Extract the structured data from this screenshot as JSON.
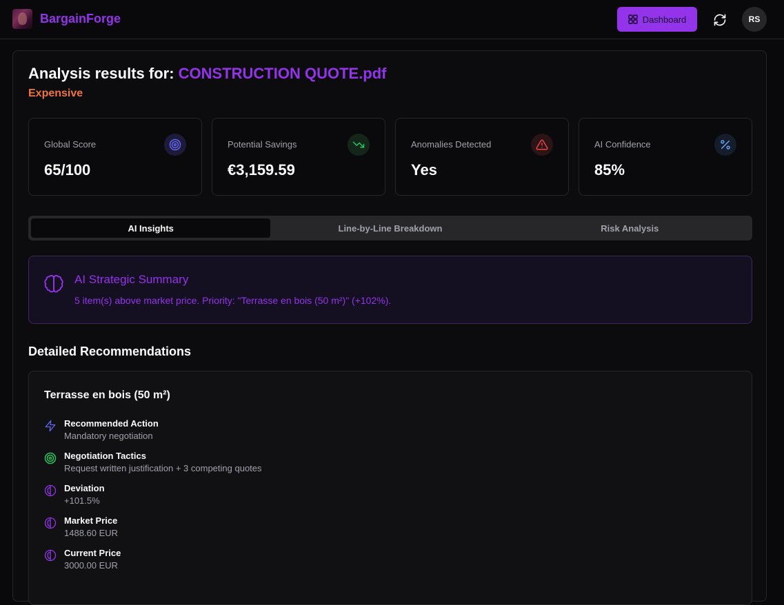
{
  "app": {
    "name": "BargainForge",
    "dashboard_label": "Dashboard",
    "user_initials": "RS"
  },
  "analysis": {
    "heading_prefix": "Analysis results for:",
    "file_name": "CONSTRUCTION QUOTE.pdf",
    "verdict": "Expensive",
    "verdict_color": "#f0743c"
  },
  "cards": [
    {
      "label": "Global Score",
      "value": "65/100",
      "icon": "target-icon",
      "color": "#4f46e5"
    },
    {
      "label": "Potential Savings",
      "value": "€3,159.59",
      "icon": "trending-down-icon",
      "color": "#22c55e"
    },
    {
      "label": "Anomalies Detected",
      "value": "Yes",
      "icon": "alert-triangle-icon",
      "color": "#ef4444"
    },
    {
      "label": "AI Confidence",
      "value": "85%",
      "icon": "percent-icon",
      "color": "#60a5fa"
    }
  ],
  "tabs": [
    {
      "label": "AI Insights",
      "active": true
    },
    {
      "label": "Line-by-Line Breakdown",
      "active": false
    },
    {
      "label": "Risk Analysis",
      "active": false
    }
  ],
  "summary": {
    "title": "AI Strategic Summary",
    "text": "5 item(s) above market price. Priority: \"Terrasse en bois (50 m²)\" (+102%)."
  },
  "recommendations": {
    "section_title": "Detailed Recommendations",
    "item_title": "Terrasse en bois (50 m²)",
    "rows": [
      {
        "label": "Recommended Action",
        "value": "Mandatory negotiation",
        "icon": "zap-icon"
      },
      {
        "label": "Negotiation Tactics",
        "value": "Request written justification + 3 competing quotes",
        "icon": "target-icon"
      },
      {
        "label": "Deviation",
        "value": "+101.5%",
        "icon": "brain-icon"
      },
      {
        "label": "Market Price",
        "value": "1488.60 EUR",
        "icon": "brain-icon"
      },
      {
        "label": "Current Price",
        "value": "3000.00 EUR",
        "icon": "brain-icon"
      }
    ]
  },
  "colors": {
    "accent": "#9333ea",
    "background": "#09090b",
    "border": "#27272a"
  }
}
